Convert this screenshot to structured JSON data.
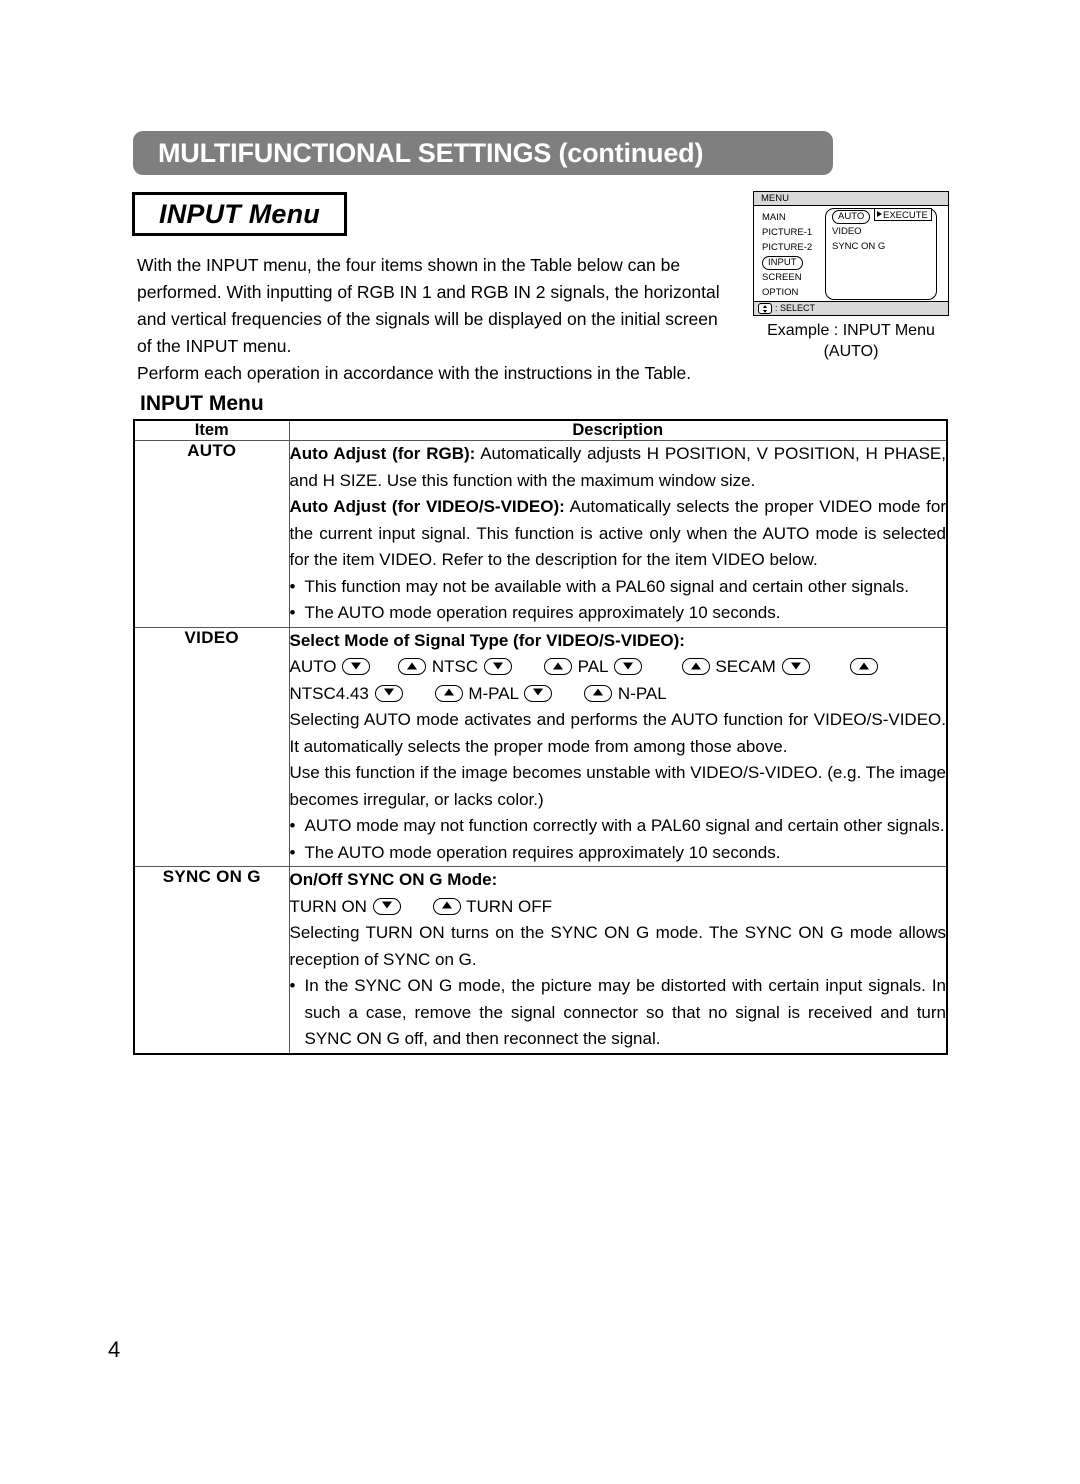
{
  "header": {
    "title": "MULTIFUNCTIONAL SETTINGS (continued)"
  },
  "section": {
    "title_box": "INPUT Menu",
    "intro_paragraph_1": "With the INPUT menu, the four items shown in the Table below can be performed. With inputting of RGB IN 1 and RGB IN 2 signals, the horizontal and vertical frequencies of the signals will be displayed on the initial screen of the INPUT menu.",
    "intro_paragraph_2": "Perform each operation in accordance with the instructions in the Table.",
    "table_heading": "INPUT Menu"
  },
  "osd": {
    "titlebar": "MENU",
    "main_items": [
      "MAIN",
      "PICTURE-1",
      "PICTURE-2",
      "INPUT",
      "SCREEN",
      "OPTION"
    ],
    "highlighted_main": "INPUT",
    "sub_items": [
      "AUTO",
      "VIDEO",
      "SYNC ON G"
    ],
    "highlighted_sub": "AUTO",
    "execute_label": "EXECUTE",
    "footer_label": ": SELECT",
    "caption_line1": "Example : INPUT Menu",
    "caption_line2": "(AUTO)"
  },
  "table": {
    "headers": {
      "item": "Item",
      "description": "Description"
    },
    "rows": [
      {
        "item": "AUTO",
        "blocks": [
          {
            "type": "paragraph",
            "bold_lead": "Auto Adjust (for RGB):",
            "text": " Automatically adjusts H POSITION, V POSITION, H PHASE, and H SIZE. Use this function with the maximum window size."
          },
          {
            "type": "paragraph",
            "bold_lead": "Auto Adjust (for VIDEO/S-VIDEO):",
            "text": " Automatically selects the proper VIDEO mode for the current input signal. This function is active only when the AUTO mode is selected for the item VIDEO. Refer to the description for the item VIDEO below."
          },
          {
            "type": "bullets",
            "items": [
              "This function may not be available with a PAL60 signal and certain other signals.",
              "The AUTO mode operation requires approximately 10 seconds."
            ]
          }
        ]
      },
      {
        "item": "VIDEO",
        "blocks": [
          {
            "type": "heading",
            "text": "Select Mode of Signal Type (for VIDEO/S-VIDEO):"
          },
          {
            "type": "signal_chain",
            "line1": [
              "AUTO",
              "NTSC",
              "PAL",
              "SECAM"
            ],
            "line2": [
              "NTSC4.43",
              "M-PAL",
              "N-PAL"
            ]
          },
          {
            "type": "paragraph",
            "text": "Selecting AUTO mode activates and performs the AUTO function for VIDEO/S-VIDEO. It automatically selects the proper mode from among those above."
          },
          {
            "type": "paragraph",
            "text": "Use this function if the image becomes unstable with VIDEO/S-VIDEO. (e.g. The image becomes irregular, or lacks color.)"
          },
          {
            "type": "bullets",
            "items": [
              "AUTO mode may not function correctly with a PAL60 signal and certain other signals.",
              "The AUTO mode operation requires approximately 10 seconds."
            ]
          }
        ]
      },
      {
        "item": "SYNC ON G",
        "blocks": [
          {
            "type": "heading",
            "text": "On/Off SYNC ON G Mode:"
          },
          {
            "type": "toggle_chain",
            "left": "TURN ON",
            "right": "TURN OFF"
          },
          {
            "type": "paragraph",
            "text": "Selecting TURN ON turns on the SYNC ON G mode. The SYNC ON G mode allows reception of SYNC on G."
          },
          {
            "type": "bullets",
            "items": [
              "In the SYNC ON G mode, the picture may be distorted with certain input signals. In such a case, remove the signal connector so that no signal is received and turn SYNC ON G off, and then reconnect the signal."
            ]
          }
        ]
      }
    ]
  },
  "footer": {
    "page_number": "4"
  }
}
